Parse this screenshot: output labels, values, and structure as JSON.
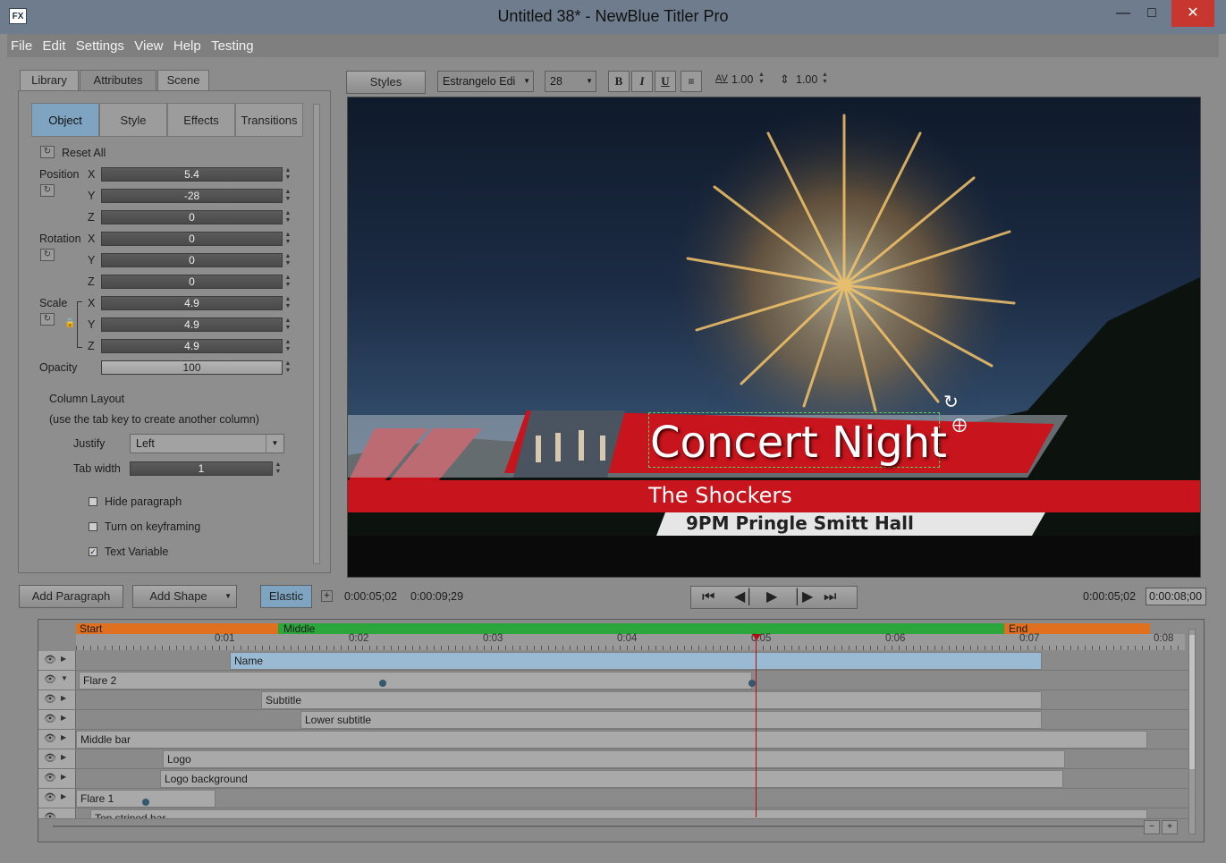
{
  "window": {
    "title": "Untitled 38* - NewBlue Titler Pro",
    "icon": "FX"
  },
  "menu": [
    "File",
    "Edit",
    "Settings",
    "View",
    "Help",
    "Testing"
  ],
  "left_tabs": [
    "Library",
    "Attributes",
    "Scene"
  ],
  "sub_tabs": [
    "Object",
    "Style",
    "Effects",
    "Transitions"
  ],
  "attributes": {
    "reset_all": "Reset All",
    "position_label": "Position",
    "rotation_label": "Rotation",
    "scale_label": "Scale",
    "opacity_label": "Opacity",
    "axis_x": "X",
    "axis_y": "Y",
    "axis_z": "Z",
    "position": {
      "x": "5.4",
      "y": "-28",
      "z": "0"
    },
    "rotation": {
      "x": "0",
      "y": "0",
      "z": "0"
    },
    "scale": {
      "x": "4.9",
      "y": "4.9",
      "z": "4.9"
    },
    "opacity": "100",
    "column_layout": "Column Layout",
    "column_hint": "(use the tab key to create another column)",
    "justify_label": "Justify",
    "justify_value": "Left",
    "tab_width_label": "Tab width",
    "tab_width_value": "1",
    "hide_paragraph": "Hide paragraph",
    "turn_on_keyframing": "Turn on keyframing",
    "text_variable": "Text Variable"
  },
  "toolbar": {
    "styles": "Styles",
    "font": "Estrangelo Edi",
    "size": "28",
    "bold": "B",
    "italic": "I",
    "underline": "U",
    "kerning_icon": "AV",
    "kerning": "1.00",
    "leading": "1.00"
  },
  "preview": {
    "title": "Concert Night",
    "subtitle": "The Shockers",
    "lower_subtitle": "9PM Pringle Smitt Hall"
  },
  "bottom": {
    "add_paragraph": "Add Paragraph",
    "add_shape": "Add Shape",
    "elastic": "Elastic",
    "tc_current": "0:00:05;02",
    "tc_duration": "0:00:09;29",
    "tc_right_current": "0:00:05;02",
    "tc_right_total": "0:00:08;00"
  },
  "timeline": {
    "sections": {
      "start": "Start",
      "middle": "Middle",
      "end": "End"
    },
    "ticks": [
      "0:01",
      "0:02",
      "0:03",
      "0:04",
      "0:05",
      "0:06",
      "0:07",
      "0:08"
    ],
    "tracks": [
      "Name",
      "Flare 2",
      "Subtitle",
      "Lower subtitle",
      "Middle bar",
      "Logo",
      "Logo background",
      "Flare 1",
      "Top striped bar"
    ]
  },
  "colors": {
    "accent": "#7ea4c2",
    "bar_red": "#c8141c",
    "start": "#e0701e",
    "middle": "#2aa63a",
    "end": "#e0701e"
  }
}
